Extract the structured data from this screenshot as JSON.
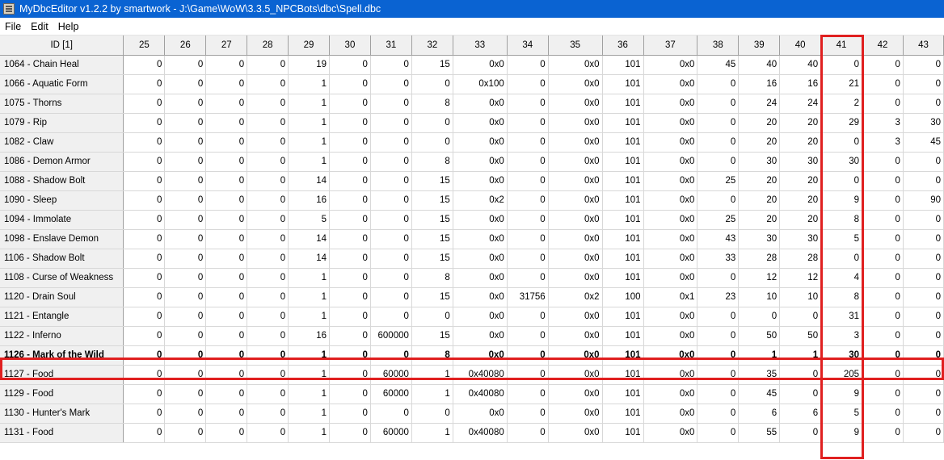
{
  "window": {
    "title": "MyDbcEditor v1.2.2 by smartwork - J:\\Game\\WoW\\3.3.5_NPCBots\\dbc\\Spell.dbc"
  },
  "menu": [
    "File",
    "Edit",
    "Help"
  ],
  "table": {
    "headers": [
      "ID [1]",
      "25",
      "26",
      "27",
      "28",
      "29",
      "30",
      "31",
      "32",
      "33",
      "34",
      "35",
      "36",
      "37",
      "38",
      "39",
      "40",
      "41",
      "42",
      "43"
    ],
    "selected_row": 15,
    "highlight_column": "41",
    "rows": [
      [
        "1064 - Chain Heal",
        "0",
        "0",
        "0",
        "0",
        "19",
        "0",
        "0",
        "15",
        "0x0",
        "0",
        "0x0",
        "101",
        "0x0",
        "45",
        "40",
        "40",
        "0",
        "0",
        "0"
      ],
      [
        "1066 - Aquatic Form",
        "0",
        "0",
        "0",
        "0",
        "1",
        "0",
        "0",
        "0",
        "0x100",
        "0",
        "0x0",
        "101",
        "0x0",
        "0",
        "16",
        "16",
        "21",
        "0",
        "0"
      ],
      [
        "1075 - Thorns",
        "0",
        "0",
        "0",
        "0",
        "1",
        "0",
        "0",
        "8",
        "0x0",
        "0",
        "0x0",
        "101",
        "0x0",
        "0",
        "24",
        "24",
        "2",
        "0",
        "0"
      ],
      [
        "1079 - Rip",
        "0",
        "0",
        "0",
        "0",
        "1",
        "0",
        "0",
        "0",
        "0x0",
        "0",
        "0x0",
        "101",
        "0x0",
        "0",
        "20",
        "20",
        "29",
        "3",
        "30"
      ],
      [
        "1082 - Claw",
        "0",
        "0",
        "0",
        "0",
        "1",
        "0",
        "0",
        "0",
        "0x0",
        "0",
        "0x0",
        "101",
        "0x0",
        "0",
        "20",
        "20",
        "0",
        "3",
        "45"
      ],
      [
        "1086 - Demon Armor",
        "0",
        "0",
        "0",
        "0",
        "1",
        "0",
        "0",
        "8",
        "0x0",
        "0",
        "0x0",
        "101",
        "0x0",
        "0",
        "30",
        "30",
        "30",
        "0",
        "0"
      ],
      [
        "1088 - Shadow Bolt",
        "0",
        "0",
        "0",
        "0",
        "14",
        "0",
        "0",
        "15",
        "0x0",
        "0",
        "0x0",
        "101",
        "0x0",
        "25",
        "20",
        "20",
        "0",
        "0",
        "0"
      ],
      [
        "1090 - Sleep",
        "0",
        "0",
        "0",
        "0",
        "16",
        "0",
        "0",
        "15",
        "0x2",
        "0",
        "0x0",
        "101",
        "0x0",
        "0",
        "20",
        "20",
        "9",
        "0",
        "90"
      ],
      [
        "1094 - Immolate",
        "0",
        "0",
        "0",
        "0",
        "5",
        "0",
        "0",
        "15",
        "0x0",
        "0",
        "0x0",
        "101",
        "0x0",
        "25",
        "20",
        "20",
        "8",
        "0",
        "0"
      ],
      [
        "1098 - Enslave Demon",
        "0",
        "0",
        "0",
        "0",
        "14",
        "0",
        "0",
        "15",
        "0x0",
        "0",
        "0x0",
        "101",
        "0x0",
        "43",
        "30",
        "30",
        "5",
        "0",
        "0"
      ],
      [
        "1106 - Shadow Bolt",
        "0",
        "0",
        "0",
        "0",
        "14",
        "0",
        "0",
        "15",
        "0x0",
        "0",
        "0x0",
        "101",
        "0x0",
        "33",
        "28",
        "28",
        "0",
        "0",
        "0"
      ],
      [
        "1108 - Curse of Weakness",
        "0",
        "0",
        "0",
        "0",
        "1",
        "0",
        "0",
        "8",
        "0x0",
        "0",
        "0x0",
        "101",
        "0x0",
        "0",
        "12",
        "12",
        "4",
        "0",
        "0"
      ],
      [
        "1120 - Drain Soul",
        "0",
        "0",
        "0",
        "0",
        "1",
        "0",
        "0",
        "15",
        "0x0",
        "31756",
        "0x2",
        "100",
        "0x1",
        "23",
        "10",
        "10",
        "8",
        "0",
        "0"
      ],
      [
        "1121 - Entangle",
        "0",
        "0",
        "0",
        "0",
        "1",
        "0",
        "0",
        "0",
        "0x0",
        "0",
        "0x0",
        "101",
        "0x0",
        "0",
        "0",
        "0",
        "31",
        "0",
        "0"
      ],
      [
        "1122 - Inferno",
        "0",
        "0",
        "0",
        "0",
        "16",
        "0",
        "600000",
        "15",
        "0x0",
        "0",
        "0x0",
        "101",
        "0x0",
        "0",
        "50",
        "50",
        "3",
        "0",
        "0"
      ],
      [
        "1126 - Mark of the Wild",
        "0",
        "0",
        "0",
        "0",
        "1",
        "0",
        "0",
        "8",
        "0x0",
        "0",
        "0x0",
        "101",
        "0x0",
        "0",
        "1",
        "1",
        "30",
        "0",
        "0"
      ],
      [
        "1127 - Food",
        "0",
        "0",
        "0",
        "0",
        "1",
        "0",
        "60000",
        "1",
        "0x40080",
        "0",
        "0x0",
        "101",
        "0x0",
        "0",
        "35",
        "0",
        "205",
        "0",
        "0"
      ],
      [
        "1129 - Food",
        "0",
        "0",
        "0",
        "0",
        "1",
        "0",
        "60000",
        "1",
        "0x40080",
        "0",
        "0x0",
        "101",
        "0x0",
        "0",
        "45",
        "0",
        "9",
        "0",
        "0"
      ],
      [
        "1130 - Hunter's Mark",
        "0",
        "0",
        "0",
        "0",
        "1",
        "0",
        "0",
        "0",
        "0x0",
        "0",
        "0x0",
        "101",
        "0x0",
        "0",
        "6",
        "6",
        "5",
        "0",
        "0"
      ],
      [
        "1131 - Food",
        "0",
        "0",
        "0",
        "0",
        "1",
        "0",
        "60000",
        "1",
        "0x40080",
        "0",
        "0x0",
        "101",
        "0x0",
        "0",
        "55",
        "0",
        "9",
        "0",
        "0"
      ]
    ]
  },
  "colors": {
    "titlebar": "#0a63d2",
    "highlight": "#e02020",
    "header_bg": "#f0f0f0"
  }
}
